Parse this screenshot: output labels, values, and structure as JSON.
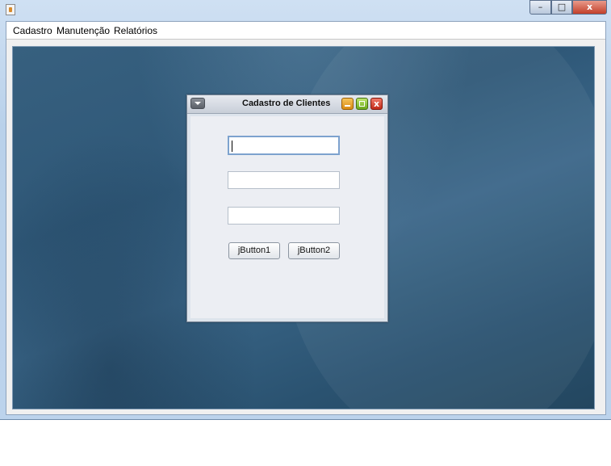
{
  "window": {
    "controls": {
      "minimize": "–",
      "maximize": "□",
      "close": "x"
    }
  },
  "menubar": {
    "items": [
      {
        "label": "Cadastro"
      },
      {
        "label": "Manutenção"
      },
      {
        "label": "Relatórios"
      }
    ]
  },
  "internal_frame": {
    "title": "Cadastro de Clientes",
    "close_glyph": "x",
    "fields": [
      {
        "value": "",
        "focused": true
      },
      {
        "value": ""
      },
      {
        "value": ""
      }
    ],
    "buttons": [
      {
        "label": "jButton1"
      },
      {
        "label": "jButton2"
      }
    ]
  },
  "colors": {
    "desktop": "#2f5878",
    "frame_background": "#eceef3",
    "minimize_button": "#f6c45a",
    "maximize_button": "#6aa81c",
    "close_button": "#c22a18"
  }
}
